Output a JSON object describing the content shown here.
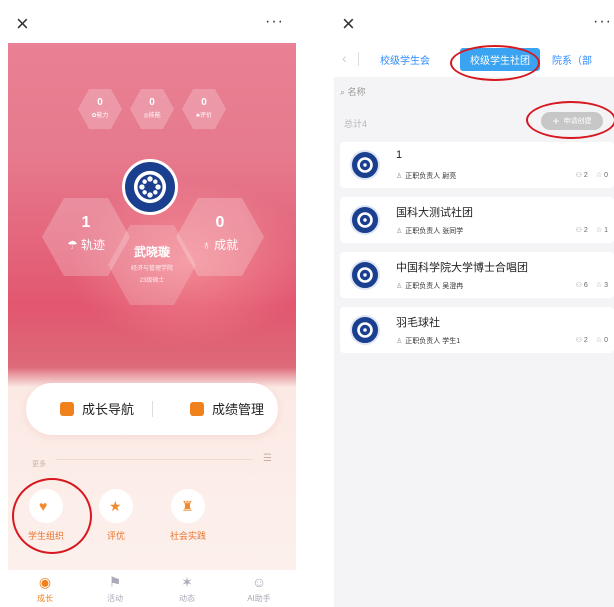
{
  "left": {
    "top_bar": {
      "close_icon": "×",
      "more_icon": "···"
    },
    "small_stats": [
      {
        "value": "0",
        "icon": "✿",
        "label": "能力"
      },
      {
        "value": "0",
        "icon": "◎",
        "label": "技能"
      },
      {
        "value": "0",
        "icon": "♣",
        "label": "评价"
      }
    ],
    "big_stats": {
      "trajectory": {
        "value": "1",
        "icon": "☂",
        "label": "轨迹"
      },
      "achievement": {
        "value": "0",
        "icon": "♁",
        "label": "成就"
      }
    },
    "profile": {
      "name": "武晓璇",
      "line1": "经济与管理学院",
      "line2": "23级硕士"
    },
    "nav": {
      "item1": "成长导航",
      "item2": "成绩管理"
    },
    "more": {
      "label": "更多",
      "filter_icon": "☰"
    },
    "features": [
      {
        "icon": "♥",
        "label": "学生组织"
      },
      {
        "icon": "★",
        "label": "评优"
      },
      {
        "icon": "♜",
        "label": "社会实践"
      }
    ],
    "tabbar": [
      {
        "icon": "◉",
        "label": "成长",
        "active": true
      },
      {
        "icon": "⚑",
        "label": "活动",
        "active": false
      },
      {
        "icon": "✶",
        "label": "动态",
        "active": false
      },
      {
        "icon": "☺",
        "label": "AI助手",
        "active": false
      }
    ],
    "colors": {
      "accent": "#f0821c",
      "annotation": "#d61820"
    }
  },
  "right": {
    "top_bar": {
      "close_icon": "×",
      "more_icon": "···"
    },
    "tabs": {
      "back_icon": "‹",
      "items": [
        "校级学生会",
        "校级学生社团",
        "院系（部"
      ],
      "selected_index": 1
    },
    "search": {
      "icon": "⌕",
      "placeholder": "名称"
    },
    "total": "总计4",
    "apply_button": {
      "icon": "+",
      "label": "申请创建"
    },
    "cards": [
      {
        "title": "1",
        "leader_label": "正职负责人",
        "leader": "尉亮",
        "members": "2",
        "stars": "0"
      },
      {
        "title": "国科大测试社团",
        "leader_label": "正职负责人",
        "leader": "张同学",
        "members": "2",
        "stars": "1"
      },
      {
        "title": "中国科学院大学博士合唱团",
        "leader_label": "正职负责人",
        "leader": "吴澄冉",
        "members": "6",
        "stars": "3"
      },
      {
        "title": "羽毛球社",
        "leader_label": "正职负责人",
        "leader": "学生1",
        "members": "2",
        "stars": "0"
      }
    ],
    "icons": {
      "person": "♙",
      "members": "⚇",
      "star": "☆"
    },
    "colors": {
      "tab_blue": "#2d8cff",
      "tab_selected_bg": "#3aa3f2"
    }
  }
}
